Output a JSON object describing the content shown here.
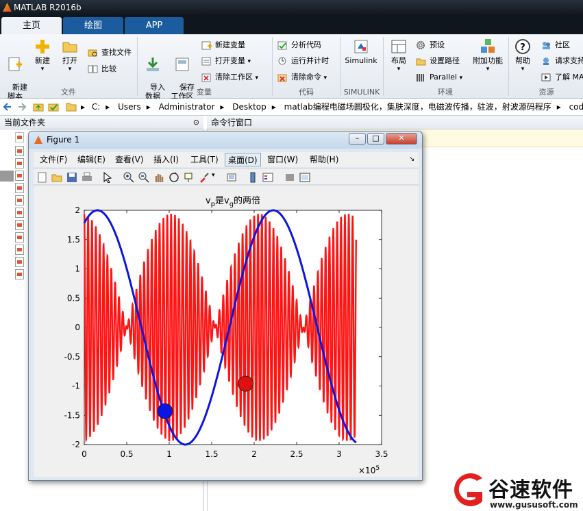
{
  "window": {
    "title": "MATLAB R2016b"
  },
  "tabs": [
    {
      "label": "主页",
      "active": true
    },
    {
      "label": "绘图",
      "active": false
    },
    {
      "label": "APP",
      "active": false
    }
  ],
  "ribbon": {
    "file": {
      "new_script": "新建\n脚本",
      "new": "新建",
      "open": "打开",
      "find_files": "查找文件",
      "compare": "比较",
      "group": "文件"
    },
    "variable": {
      "import": "导入\n数据",
      "save_ws": "保存\n工作区",
      "new_var": "新建变量",
      "open_var": "打开变量",
      "clear_ws": "清除工作区",
      "group": "变量"
    },
    "code": {
      "analyze": "分析代码",
      "run_time": "运行并计时",
      "clear_cmd": "清除命令",
      "group": "代码"
    },
    "simulink": {
      "label": "Simulink",
      "group": "SIMULINK"
    },
    "env": {
      "layout": "布局",
      "prefs": "预设",
      "set_path": "设置路径",
      "parallel": "Parallel",
      "addons": "附加功能",
      "group": "环境"
    },
    "resources": {
      "help": "帮助",
      "community": "社区",
      "support": "请求支持",
      "learn": "了解 MA",
      "group": "资源"
    }
  },
  "address": {
    "segments": [
      "C:",
      "Users",
      "Administrator",
      "Desktop",
      "matlab编程电磁场圆极化，集肤深度，电磁波传播，驻波，射波源码程序",
      "code"
    ]
  },
  "panels": {
    "current_folder": "当前文件夹",
    "command_window": "命令行窗口"
  },
  "figure": {
    "title": "Figure 1",
    "menu": [
      "文件(F)",
      "编辑(E)",
      "查看(V)",
      "插入(I)",
      "工具(T)",
      "桌面(D)",
      "窗口(W)",
      "帮助(H)"
    ],
    "controls": {
      "minimize": "–",
      "maximize": "□",
      "close": "✕"
    }
  },
  "chart_data": {
    "type": "line",
    "title": "vp是vg的两倍",
    "title_parts": {
      "a": "v",
      "sub_a": "p",
      "mid": "是v",
      "sub_b": "g",
      "end": "的两倍"
    },
    "xlim": [
      0,
      3.5
    ],
    "ylim": [
      -2,
      2
    ],
    "x_exponent": "×10",
    "x_exponent_power": "5",
    "xticks": [
      "0",
      "0.5",
      "1",
      "1.5",
      "2",
      "2.5",
      "3",
      "3.5"
    ],
    "yticks": [
      "2",
      "1.5",
      "1",
      "0.5",
      "0",
      "-0.5",
      "-1",
      "-1.5",
      "-2"
    ],
    "series": [
      {
        "color": "#0b16e0",
        "kind": "envelope",
        "amplitude": 2,
        "phase_at_zero_deg": 63,
        "period": 2.07,
        "x_end": 3.2
      },
      {
        "color": "#ff1414",
        "kind": "wave-packet",
        "envelope_amplitude": 2,
        "envelope_period": 1.04,
        "carrier_cycles_per_unit": 22,
        "x_end": 3.2
      }
    ],
    "markers": [
      {
        "x": 0.95,
        "y": -1.43,
        "color": "#0b16e0"
      },
      {
        "x": 1.9,
        "y": -0.96,
        "color": "#e01010"
      }
    ]
  },
  "watermark": {
    "text": "谷速软件",
    "url": "www.gususoft.com"
  }
}
